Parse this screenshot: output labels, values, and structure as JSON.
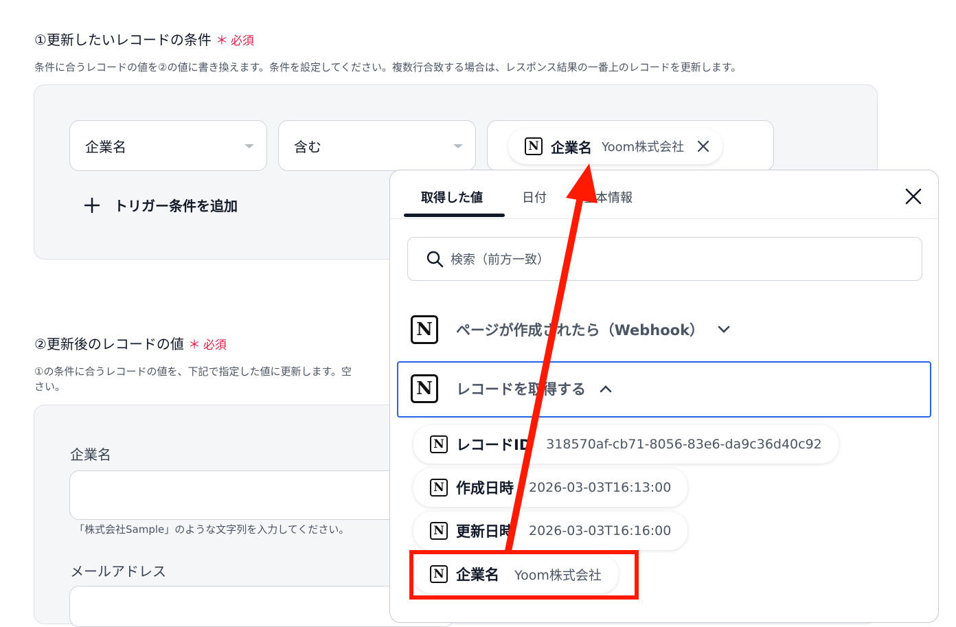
{
  "section1": {
    "title": "①更新したいレコードの条件",
    "required_mark": "＊",
    "required_label": "必須",
    "description": "条件に合うレコードの値を②の値に書き換えます。条件を設定してください。複数行合致する場合は、レスポンス結果の一番上のレコードを更新します。",
    "field_select": "企業名",
    "operator_select": "含む",
    "value_chip": {
      "name": "企業名",
      "value": "Yoom株式会社"
    },
    "add_trigger_label": "トリガー条件を追加"
  },
  "section2": {
    "title": "②更新後のレコードの値",
    "required_mark": "＊",
    "required_label": "必須",
    "description_line1": "①の条件に合うレコードの値を、下記で指定した値に更新します。空",
    "description_line2": "さい。",
    "field1_label": "企業名",
    "field1_hint": "「株式会社Sample」のような文字列を入力してください。",
    "field2_label": "メールアドレス"
  },
  "popup": {
    "tabs": [
      "取得した値",
      "日付",
      "基本情報"
    ],
    "active_tab": "取得した値",
    "search_placeholder": "検索（前方一致）",
    "groups": [
      {
        "title": "ページが作成されたら（Webhook）",
        "expanded": false
      },
      {
        "title": "レコードを取得する",
        "expanded": true
      }
    ],
    "items": [
      {
        "name": "レコードID",
        "value": "318570af-cb71-8056-83e6-da9c36d40c92"
      },
      {
        "name": "作成日時",
        "value": "2026-03-03T16:13:00"
      },
      {
        "name": "更新日時",
        "value": "2026-03-03T16:16:00"
      },
      {
        "name": "企業名",
        "value": "Yoom株式会社"
      }
    ]
  },
  "icons": {
    "notion_letter": "N",
    "notion": "notion-icon",
    "search": "search-icon",
    "close": "close-icon",
    "plus": "plus-icon",
    "chevron_down": "chevron-down-icon",
    "chevron_up": "chevron-up-icon"
  },
  "colors": {
    "required": "#e11d48",
    "annotation": "#ff1a00",
    "focus": "#2563eb"
  }
}
